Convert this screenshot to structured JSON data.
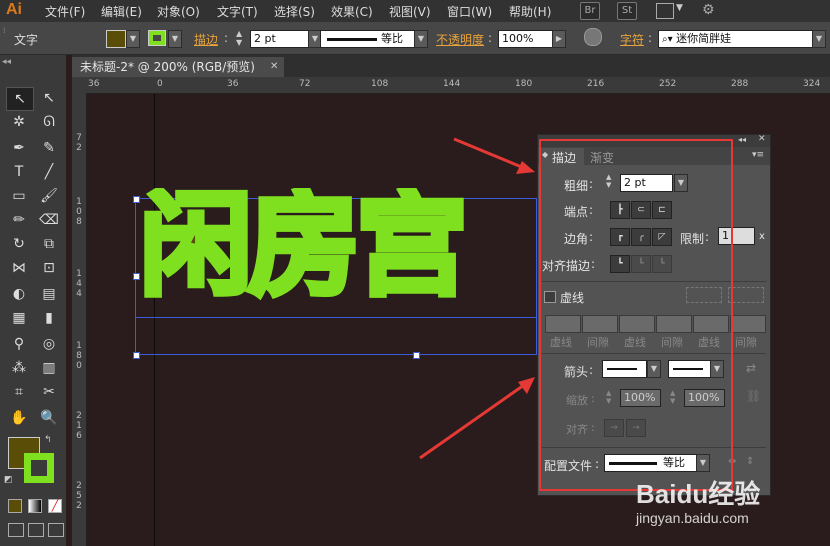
{
  "app": {
    "logo": "Ai"
  },
  "menu": [
    "文件(F)",
    "编辑(E)",
    "对象(O)",
    "文字(T)",
    "选择(S)",
    "效果(C)",
    "视图(V)",
    "窗口(W)",
    "帮助(H)"
  ],
  "menu_icons": {
    "br": "Br",
    "st": "St"
  },
  "control_bar": {
    "context_label": "文字",
    "stroke_label": "描边",
    "stroke_value": "2 pt",
    "profile_value": "等比",
    "opacity_label": "不透明度",
    "opacity_value": "100%",
    "font_label": "字符",
    "font_value": "迷你简胖娃",
    "fill_color": "#5a4d08",
    "stroke_color": "#7fe020"
  },
  "document_tab": {
    "title": "未标题-2* @ 200% (RGB/预览)",
    "close": "✕"
  },
  "ruler": {
    "top_ticks": [
      "36",
      "0",
      "36",
      "72",
      "108",
      "144",
      "180",
      "216",
      "252",
      "288",
      "324"
    ],
    "left_ticks": [
      "7\n2",
      "1\n0\n8",
      "1\n4\n4",
      "1\n8\n0",
      "2\n1\n6",
      "2\n5\n2"
    ]
  },
  "artwork": {
    "text": "闲房宫",
    "fill_color": "#5a4d08",
    "outline_color": "#7fe020"
  },
  "stroke_panel": {
    "tabs": [
      "描边",
      "渐变"
    ],
    "weight_label": "粗细",
    "weight_value": "2 pt",
    "cap_label": "端点",
    "corner_label": "边角",
    "limit_label": "限制",
    "limit_value": "1",
    "limit_unit": "x",
    "align_label": "对齐描边",
    "dashed_label": "虚线",
    "dash_cols": [
      "虚线",
      "间隙",
      "虚线",
      "间隙",
      "虚线",
      "间隙"
    ],
    "arrow_label": "箭头",
    "scale_label": "缩放",
    "scale_start": "100%",
    "scale_end": "100%",
    "align_arrow_label": "对齐",
    "profile_label": "配置文件",
    "profile_value": "等比"
  },
  "watermark": {
    "brand": "Baidu经验",
    "url": "jingyan.baidu.com"
  },
  "colors": {
    "annotation_red": "#e53935",
    "canvas_bg": "#2a1c1c",
    "panel_bg": "#535353"
  }
}
